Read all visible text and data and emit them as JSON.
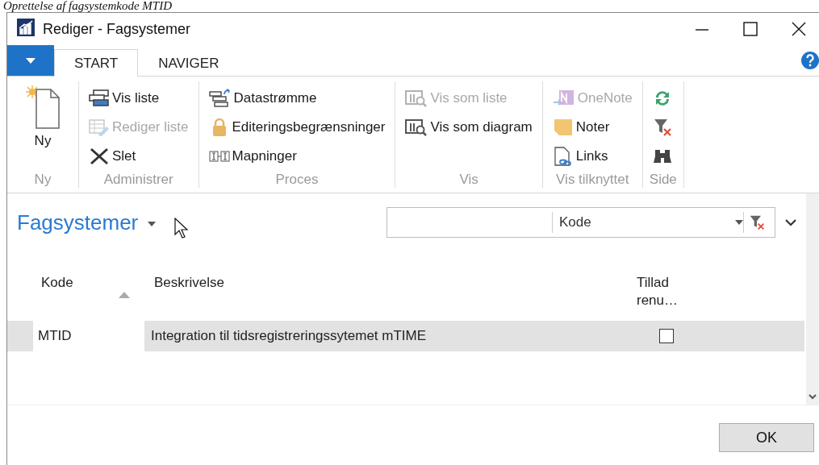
{
  "caption": "Oprettelse af fagsystemkode MTID",
  "window": {
    "title": "Rediger - Fagsystemer"
  },
  "tabs": [
    {
      "label": "START",
      "selected": true
    },
    {
      "label": "NAVIGER",
      "selected": false
    }
  ],
  "ribbon": {
    "groups": [
      {
        "label": "Ny",
        "items": [
          {
            "kind": "large",
            "label": "Ny",
            "disabled": false
          }
        ]
      },
      {
        "label": "Administrer",
        "items": [
          {
            "kind": "small",
            "label": "Vis liste",
            "disabled": false
          },
          {
            "kind": "small",
            "label": "Rediger liste",
            "disabled": true
          },
          {
            "kind": "small",
            "label": "Slet",
            "disabled": false
          }
        ]
      },
      {
        "label": "Proces",
        "items": [
          {
            "kind": "small",
            "label": "Datastrømme",
            "disabled": false
          },
          {
            "kind": "small",
            "label": "Editeringsbegrænsninger",
            "disabled": false
          },
          {
            "kind": "small",
            "label": "Mapninger",
            "disabled": false
          }
        ]
      },
      {
        "label": "Vis",
        "items": [
          {
            "kind": "small",
            "label": "Vis som liste",
            "disabled": true
          },
          {
            "kind": "small",
            "label": "Vis som diagram",
            "disabled": false
          }
        ]
      },
      {
        "label": "Vis tilknyttet",
        "items": [
          {
            "kind": "small",
            "label": "OneNote",
            "disabled": true
          },
          {
            "kind": "small",
            "label": "Noter",
            "disabled": false
          },
          {
            "kind": "small",
            "label": "Links",
            "disabled": false
          }
        ]
      },
      {
        "label": "Side",
        "items": [
          {
            "kind": "icon",
            "disabled": false
          },
          {
            "kind": "icon",
            "disabled": false
          },
          {
            "kind": "icon",
            "disabled": false
          }
        ]
      }
    ]
  },
  "page": {
    "title": "Fagsystemer",
    "filter_field": "Kode"
  },
  "table": {
    "columns": [
      {
        "label": "Kode",
        "sorted": true
      },
      {
        "label": "Beskrivelse",
        "sorted": false
      },
      {
        "label": "Tillad renu…",
        "sorted": false
      }
    ],
    "rows": [
      {
        "kode": "MTID",
        "beskrivelse": "Integration til tidsregistreringssytemet mTIME",
        "checked": false,
        "selected": true
      }
    ]
  },
  "buttons": [
    "OK"
  ]
}
